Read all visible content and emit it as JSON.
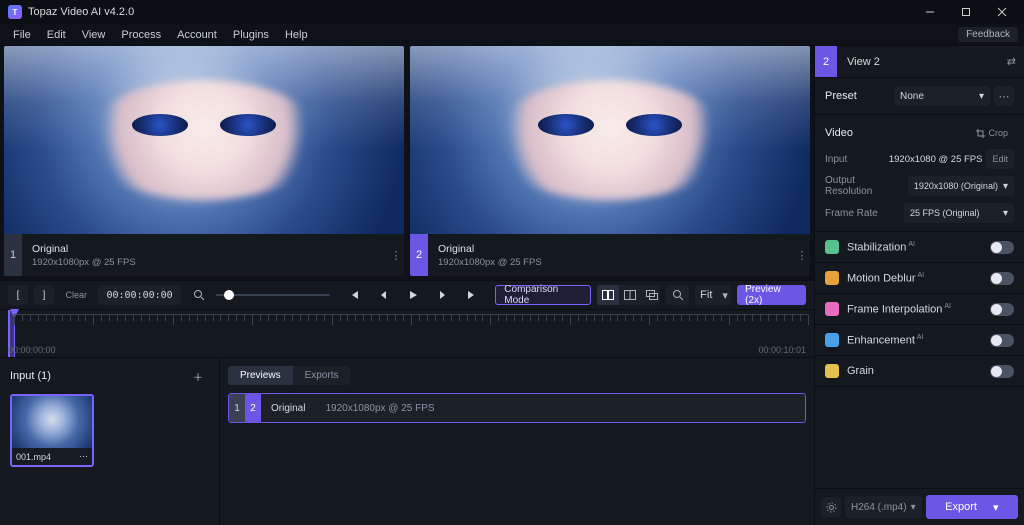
{
  "title": "Topaz Video AI  v4.2.0",
  "window_controls": {
    "min": "min-icon",
    "max": "max-icon",
    "close": "close-icon"
  },
  "menu": [
    "File",
    "Edit",
    "View",
    "Process",
    "Account",
    "Plugins",
    "Help"
  ],
  "feedback_label": "Feedback",
  "viewers": [
    {
      "num": "1",
      "name": "Original",
      "meta": "1920x1080px @ 25 FPS",
      "selected": false
    },
    {
      "num": "2",
      "name": "Original",
      "meta": "1920x1080px @ 25 FPS",
      "selected": true
    }
  ],
  "transport": {
    "in_label": "[",
    "out_label": "]",
    "clear_label": "Clear",
    "timecode": "00:00:00:00",
    "compare_label": "Comparison Mode",
    "fit_label": "Fit",
    "preview_label": "Preview (2x)"
  },
  "timeline": {
    "start": "00:00:00:00",
    "end": "00:00:10:01"
  },
  "input_panel": {
    "header": "Input (1)",
    "thumb_name": "001.mp4"
  },
  "previews": {
    "tabs": [
      "Previews",
      "Exports"
    ],
    "active_tab": 0,
    "row": {
      "n1": "1",
      "n2": "2",
      "name": "Original",
      "meta": "1920x1080px @ 25 FPS"
    }
  },
  "right": {
    "view_num": "2",
    "view_label": "View 2",
    "preset_label": "Preset",
    "preset_value": "None",
    "video_label": "Video",
    "crop_label": "Crop",
    "input_label": "Input",
    "input_value": "1920x1080 @ 25 FPS",
    "edit_label": "Edit",
    "outres_label": "Output Resolution",
    "outres_value": "1920x1080 (Original)",
    "framerate_label": "Frame Rate",
    "framerate_value": "25 FPS (Original)",
    "modules": [
      {
        "name": "Stabilization",
        "ai": true,
        "color": "#59c18e"
      },
      {
        "name": "Motion Deblur",
        "ai": true,
        "color": "#e8a13a"
      },
      {
        "name": "Frame Interpolation",
        "ai": true,
        "color": "#e86cc0"
      },
      {
        "name": "Enhancement",
        "ai": true,
        "color": "#4aa0e8"
      },
      {
        "name": "Grain",
        "ai": false,
        "color": "#e2c24d"
      }
    ],
    "export_codec": "H264 (.mp4)",
    "export_label": "Export"
  }
}
